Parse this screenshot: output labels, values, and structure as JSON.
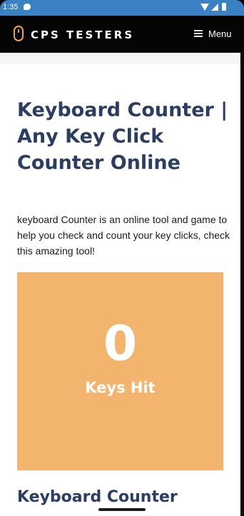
{
  "status_bar": {
    "time": "1:35",
    "icons": [
      "chat-icon",
      "wifi-icon",
      "signal-icon",
      "battery-icon"
    ],
    "background_color": "#3a82c4"
  },
  "header": {
    "brand": "CPS TESTERS",
    "menu_label": "Menu",
    "logo_icon": "mouse-icon",
    "menu_icon": "hamburger-icon",
    "accent_color": "#f0a24a"
  },
  "main": {
    "title": "Keyboard Counter | Any Key Click Counter Online",
    "intro": "keyboard Counter is an online tool and game to help you check and count your key clicks, check this amazing tool!",
    "counter": {
      "value": "0",
      "label": "Keys Hit",
      "background_color": "#f3b46e"
    },
    "next_heading": "Keyboard Counter"
  },
  "colors": {
    "heading": "#2c3e60",
    "page_background": "#ffffff"
  }
}
